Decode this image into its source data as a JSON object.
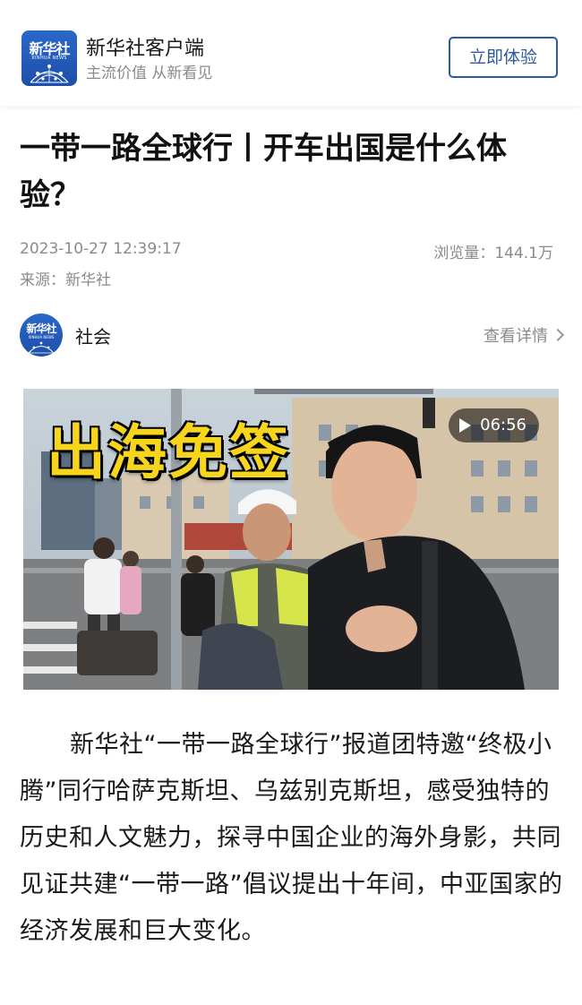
{
  "banner": {
    "logo_text": "新华社",
    "logo_sub": "XINHUA NEWS",
    "app_name": "新华社客户端",
    "slogan": "主流价值 从新看见",
    "open_label": "立即体验"
  },
  "article": {
    "title": "一带一路全球行丨开车出国是什么体验？",
    "date": "2023-10-27 12:39:17",
    "views": "浏览量：144.1万",
    "source": "来源：新华社",
    "channel": {
      "avatar_text": "新华社",
      "avatar_sub": "XINHUA NEWS",
      "name": "社会",
      "details_label": "查看详情"
    },
    "video": {
      "overlay_title": "出海免签",
      "duration": "06:56"
    },
    "body": "新华社“一带一路全球行”报道团特邀“终极小腾”同行哈萨克斯坦、乌兹别克斯坦，感受独特的历史和人文魅力，探寻中国企业的海外身影，共同见证共建“一带一路”倡议提出十年间，中亚国家的经济发展和巨大变化。"
  },
  "colors": {
    "accent": "#2d5aa0",
    "logo_blue": "#1d4fa8",
    "meta_gray": "#8a8a8a",
    "overlay_yellow": "#f7d51d"
  }
}
